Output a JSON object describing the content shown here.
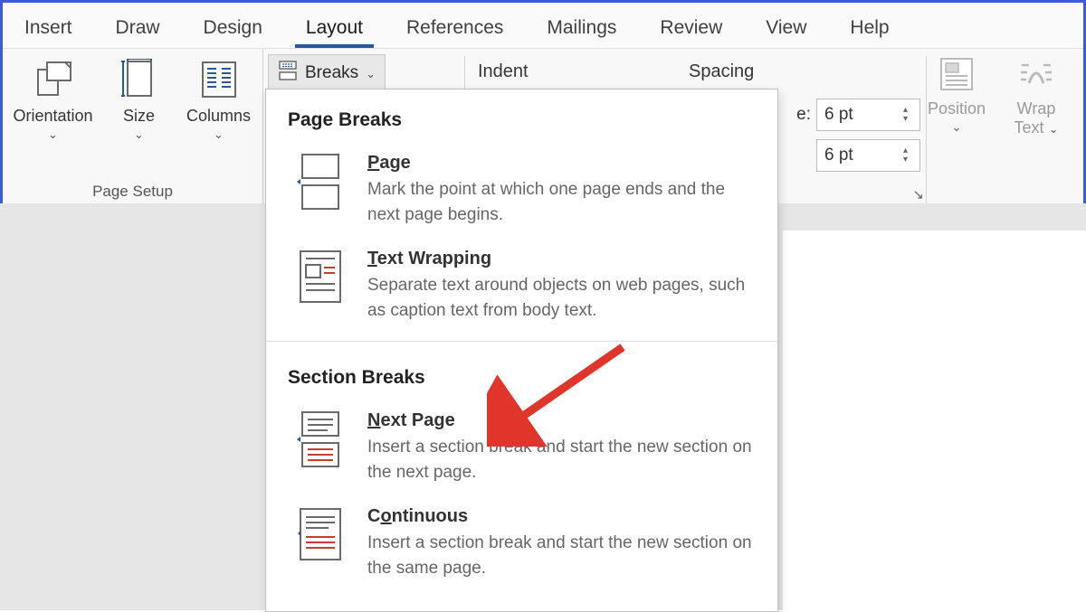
{
  "tabs": [
    "Insert",
    "Draw",
    "Design",
    "Layout",
    "References",
    "Mailings",
    "Review",
    "View",
    "Help"
  ],
  "active_tab": "Layout",
  "page_setup": {
    "orientation": "Orientation",
    "size": "Size",
    "columns": "Columns",
    "group_label": "Page Setup"
  },
  "breaks_button": "Breaks",
  "paragraph": {
    "indent_label": "Indent",
    "spacing_label": "Spacing",
    "before_suffix": "e:",
    "before_value": "6 pt",
    "after_value": "6 pt"
  },
  "arrange": {
    "position": "Position",
    "wrap": "Wrap",
    "wrap2": "Text"
  },
  "dropdown": {
    "section1": "Page Breaks",
    "items1": [
      {
        "title_pre": "P",
        "title_rest": "age",
        "desc": "Mark the point at which one page ends and the next page begins."
      },
      {
        "title_pre": "T",
        "title_rest": "ext Wrapping",
        "desc": "Separate text around objects on web pages, such as caption text from body text."
      }
    ],
    "section2": "Section Breaks",
    "items2": [
      {
        "title_pre": "N",
        "title_rest": "ext Page",
        "desc": "Insert a section break and start the new section on the next page."
      },
      {
        "title_pre": "C",
        "title_mid": "o",
        "title_rest": "ntinuous",
        "desc": "Insert a section break and start the new section on the same page."
      }
    ]
  }
}
